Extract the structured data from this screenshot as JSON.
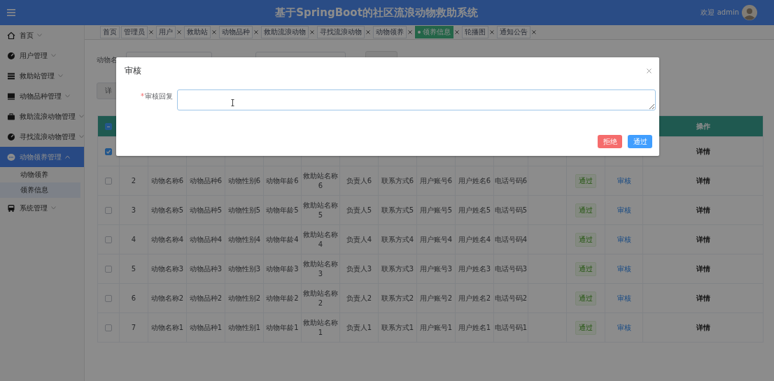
{
  "header": {
    "title": "基于SpringBoot的社区流浪动物救助系统",
    "welcome": "欢迎 admin"
  },
  "sidebar": {
    "items": [
      {
        "label": "首页",
        "expanded": false,
        "selected": false
      },
      {
        "label": "用户管理",
        "expanded": false,
        "selected": false
      },
      {
        "label": "救助站管理",
        "expanded": false,
        "selected": false
      },
      {
        "label": "动物品种管理",
        "expanded": false,
        "selected": false
      },
      {
        "label": "救助流浪动物管理",
        "expanded": false,
        "selected": false
      },
      {
        "label": "寻找流浪动物管理",
        "expanded": false,
        "selected": false
      },
      {
        "label": "动物领养管理",
        "expanded": true,
        "selected": true,
        "children": [
          {
            "label": "动物领养",
            "selected": false
          },
          {
            "label": "领养信息",
            "selected": true
          }
        ]
      },
      {
        "label": "系统管理",
        "expanded": false,
        "selected": false
      }
    ]
  },
  "tabs": [
    {
      "label": "首页",
      "closable": false,
      "selected": false
    },
    {
      "label": "管理员",
      "closable": true,
      "selected": false
    },
    {
      "label": "用户",
      "closable": true,
      "selected": false
    },
    {
      "label": "救助站",
      "closable": true,
      "selected": false
    },
    {
      "label": "动物品种",
      "closable": true,
      "selected": false
    },
    {
      "label": "救助流浪动物",
      "closable": true,
      "selected": false
    },
    {
      "label": "寻找流浪动物",
      "closable": true,
      "selected": false
    },
    {
      "label": "动物领养",
      "closable": true,
      "selected": false
    },
    {
      "label": "领养信息",
      "closable": true,
      "selected": true
    },
    {
      "label": "轮播图",
      "closable": true,
      "selected": false
    },
    {
      "label": "通知公告",
      "closable": true,
      "selected": false
    }
  ],
  "filter": {
    "label": "动物名"
  },
  "toolbar": {
    "button": "详"
  },
  "table": {
    "select_all_indeterminate": true,
    "action_column": "操作",
    "rows": [
      {
        "checked": true,
        "action": "详情"
      },
      {
        "checked": false,
        "index": "2",
        "name": "动物名称6",
        "breed": "动物品种6",
        "gender": "动物性别6",
        "age": "动物年龄6",
        "station": "救助站名称6",
        "manager": "负责人6",
        "contact": "联系方式6",
        "account": "用户账号6",
        "username": "用户姓名6",
        "phone": "电话号码6",
        "status": "通过",
        "review": "审核",
        "action": "详情"
      },
      {
        "checked": false,
        "index": "3",
        "name": "动物名称5",
        "breed": "动物品种5",
        "gender": "动物性别5",
        "age": "动物年龄5",
        "station": "救助站名称5",
        "manager": "负责人5",
        "contact": "联系方式5",
        "account": "用户账号5",
        "username": "用户姓名5",
        "phone": "电话号码5",
        "status": "通过",
        "review": "审核",
        "action": "详情"
      },
      {
        "checked": false,
        "index": "4",
        "name": "动物名称4",
        "breed": "动物品种4",
        "gender": "动物性别4",
        "age": "动物年龄4",
        "station": "救助站名称4",
        "manager": "负责人4",
        "contact": "联系方式4",
        "account": "用户账号4",
        "username": "用户姓名4",
        "phone": "电话号码4",
        "status": "通过",
        "review": "审核",
        "action": "详情"
      },
      {
        "checked": false,
        "index": "5",
        "name": "动物名称3",
        "breed": "动物品种3",
        "gender": "动物性别3",
        "age": "动物年龄3",
        "station": "救助站名称3",
        "manager": "负责人3",
        "contact": "联系方式3",
        "account": "用户账号3",
        "username": "用户姓名3",
        "phone": "电话号码3",
        "status": "通过",
        "review": "审核",
        "action": "详情"
      },
      {
        "checked": false,
        "index": "6",
        "name": "动物名称2",
        "breed": "动物品种2",
        "gender": "动物性别2",
        "age": "动物年龄2",
        "station": "救助站名称2",
        "manager": "负责人2",
        "contact": "联系方式2",
        "account": "用户账号2",
        "username": "用户姓名2",
        "phone": "电话号码2",
        "status": "通过",
        "review": "审核",
        "action": "详情"
      },
      {
        "checked": false,
        "index": "7",
        "name": "动物名称1",
        "breed": "动物品种1",
        "gender": "动物性别1",
        "age": "动物年龄1",
        "station": "救助站名称1",
        "manager": "负责人1",
        "contact": "联系方式1",
        "account": "用户账号1",
        "username": "用户姓名1",
        "phone": "电话号码1",
        "status": "通过",
        "review": "审核",
        "action": "详情"
      }
    ]
  },
  "dialog": {
    "title": "审核",
    "field": {
      "required_mark": "*",
      "label": "审核回复"
    },
    "buttons": [
      {
        "label": "拒绝",
        "kind": "danger"
      },
      {
        "label": "通过",
        "kind": "primary"
      }
    ]
  }
}
